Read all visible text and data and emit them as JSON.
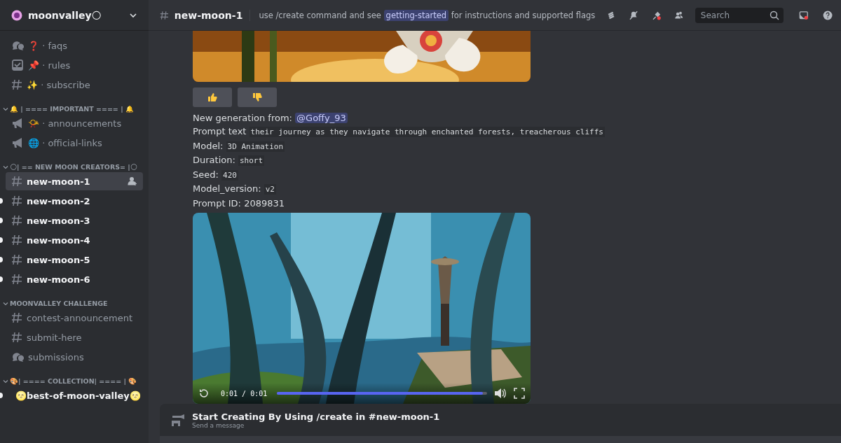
{
  "server": {
    "name": "moonvalley🌕"
  },
  "sidebar": {
    "groups": [
      {
        "channels": [
          {
            "kind": "forum",
            "label": "❓ · faqs",
            "unread": false,
            "selected": false
          },
          {
            "kind": "rules",
            "label": "📌 · rules",
            "unread": false,
            "selected": false
          },
          {
            "kind": "text",
            "label": "✨ · subscribe",
            "unread": false,
            "selected": false
          }
        ]
      },
      {
        "category": {
          "name": "🔔 | ==== IMPORTANT ==== | 🔔",
          "expanded": true
        },
        "channels": [
          {
            "kind": "announcement",
            "label": "📯 · announcements",
            "unread": false,
            "selected": false
          },
          {
            "kind": "announcement",
            "label": "🌐 · official-links",
            "unread": false,
            "selected": false
          }
        ]
      },
      {
        "category": {
          "name": "🌕| == NEW MOON CREATORS= |🌕",
          "expanded": true
        },
        "channels": [
          {
            "kind": "text",
            "label": "new-moon-1",
            "unread": false,
            "selected": true
          },
          {
            "kind": "text",
            "label": "new-moon-2",
            "unread": true,
            "selected": false
          },
          {
            "kind": "text",
            "label": "new-moon-3",
            "unread": true,
            "selected": false
          },
          {
            "kind": "text",
            "label": "new-moon-4",
            "unread": true,
            "selected": false
          },
          {
            "kind": "text",
            "label": "new-moon-5",
            "unread": true,
            "selected": false
          },
          {
            "kind": "text",
            "label": "new-moon-6",
            "unread": true,
            "selected": false
          }
        ]
      },
      {
        "category": {
          "name": "MOONVALLEY CHALLENGE",
          "expanded": true
        },
        "channels": [
          {
            "kind": "text",
            "label": "contest-announcement",
            "unread": false,
            "selected": false
          },
          {
            "kind": "text",
            "label": "submit-here",
            "unread": false,
            "selected": false
          },
          {
            "kind": "forum",
            "label": "submissions",
            "unread": false,
            "selected": false
          }
        ]
      },
      {
        "category": {
          "name": "🎨| ==== COLLECTION| ==== | 🎨",
          "expanded": true
        },
        "channels": [
          {
            "kind": "text",
            "label": "🌝best-of-moon-valley🌝",
            "unread": true,
            "selected": false
          }
        ]
      }
    ]
  },
  "header": {
    "channel": "new-moon-1",
    "topic_before": "use /create command and see",
    "topic_link": "getting-started",
    "topic_after": "for instructions and supported flags",
    "search": {
      "placeholder": "Search"
    }
  },
  "message": {
    "reactions": [
      {
        "kind": "up"
      },
      {
        "kind": "down"
      }
    ],
    "mention_label": "New generation from:",
    "mention": "@Goffy_93",
    "fields": [
      {
        "label": "Prompt text",
        "value": "their journey as they navigate through enchanted forests, treacherous cliffs",
        "kind": "code"
      },
      {
        "label": "Model:",
        "value": "3D Animation",
        "kind": "code"
      },
      {
        "label": "Duration:",
        "value": "short",
        "kind": "code"
      },
      {
        "label": "Seed:",
        "value": "420",
        "kind": "code"
      },
      {
        "label": "Model_version:",
        "value": "v2",
        "kind": "code"
      },
      {
        "label": "Prompt ID:",
        "value": "2089831",
        "kind": "plain"
      }
    ],
    "video": {
      "time": "0:01 / 0:01",
      "level": 0.98
    }
  },
  "composer": {
    "title": "Start Creating By Using /create in #new-moon-1",
    "subtitle": "Send a message"
  }
}
